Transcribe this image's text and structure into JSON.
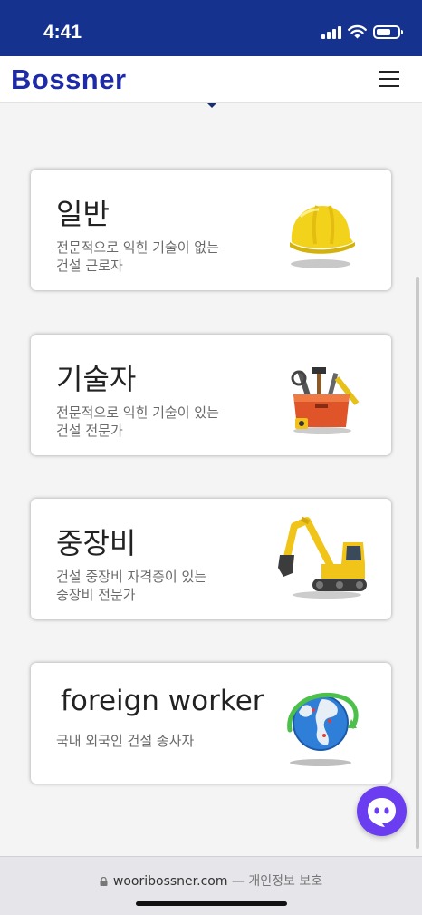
{
  "status_bar": {
    "time": "4:41"
  },
  "header": {
    "logo": "Bossner",
    "menu_icon": "hamburger-menu-icon"
  },
  "cards": [
    {
      "title": "일반",
      "desc_line1": "전문적으로 익힌 기술이 없는",
      "desc_line2": "건설 근로자",
      "icon": "hard-hat-icon"
    },
    {
      "title": "기술자",
      "desc_line1": "전문적으로 익힌 기술이 있는",
      "desc_line2": "건설 전문가",
      "icon": "toolbox-icon"
    },
    {
      "title": "중장비",
      "desc_line1": "건설 중장비 자격증이 있는",
      "desc_line2": "중장비 전문가",
      "icon": "excavator-icon"
    },
    {
      "title": "foreign worker",
      "desc_line1": "국내 외국인 건설 종사자",
      "desc_line2": "",
      "icon": "globe-icon"
    }
  ],
  "chat": {
    "icon": "chat-bubble-icon"
  },
  "browser": {
    "url": "wooribossner.com",
    "separator": " — ",
    "subtitle": "개인정보 보호"
  },
  "colors": {
    "header": "#16328f",
    "brand": "#1d2ba8",
    "chat": "#6a3df0"
  }
}
